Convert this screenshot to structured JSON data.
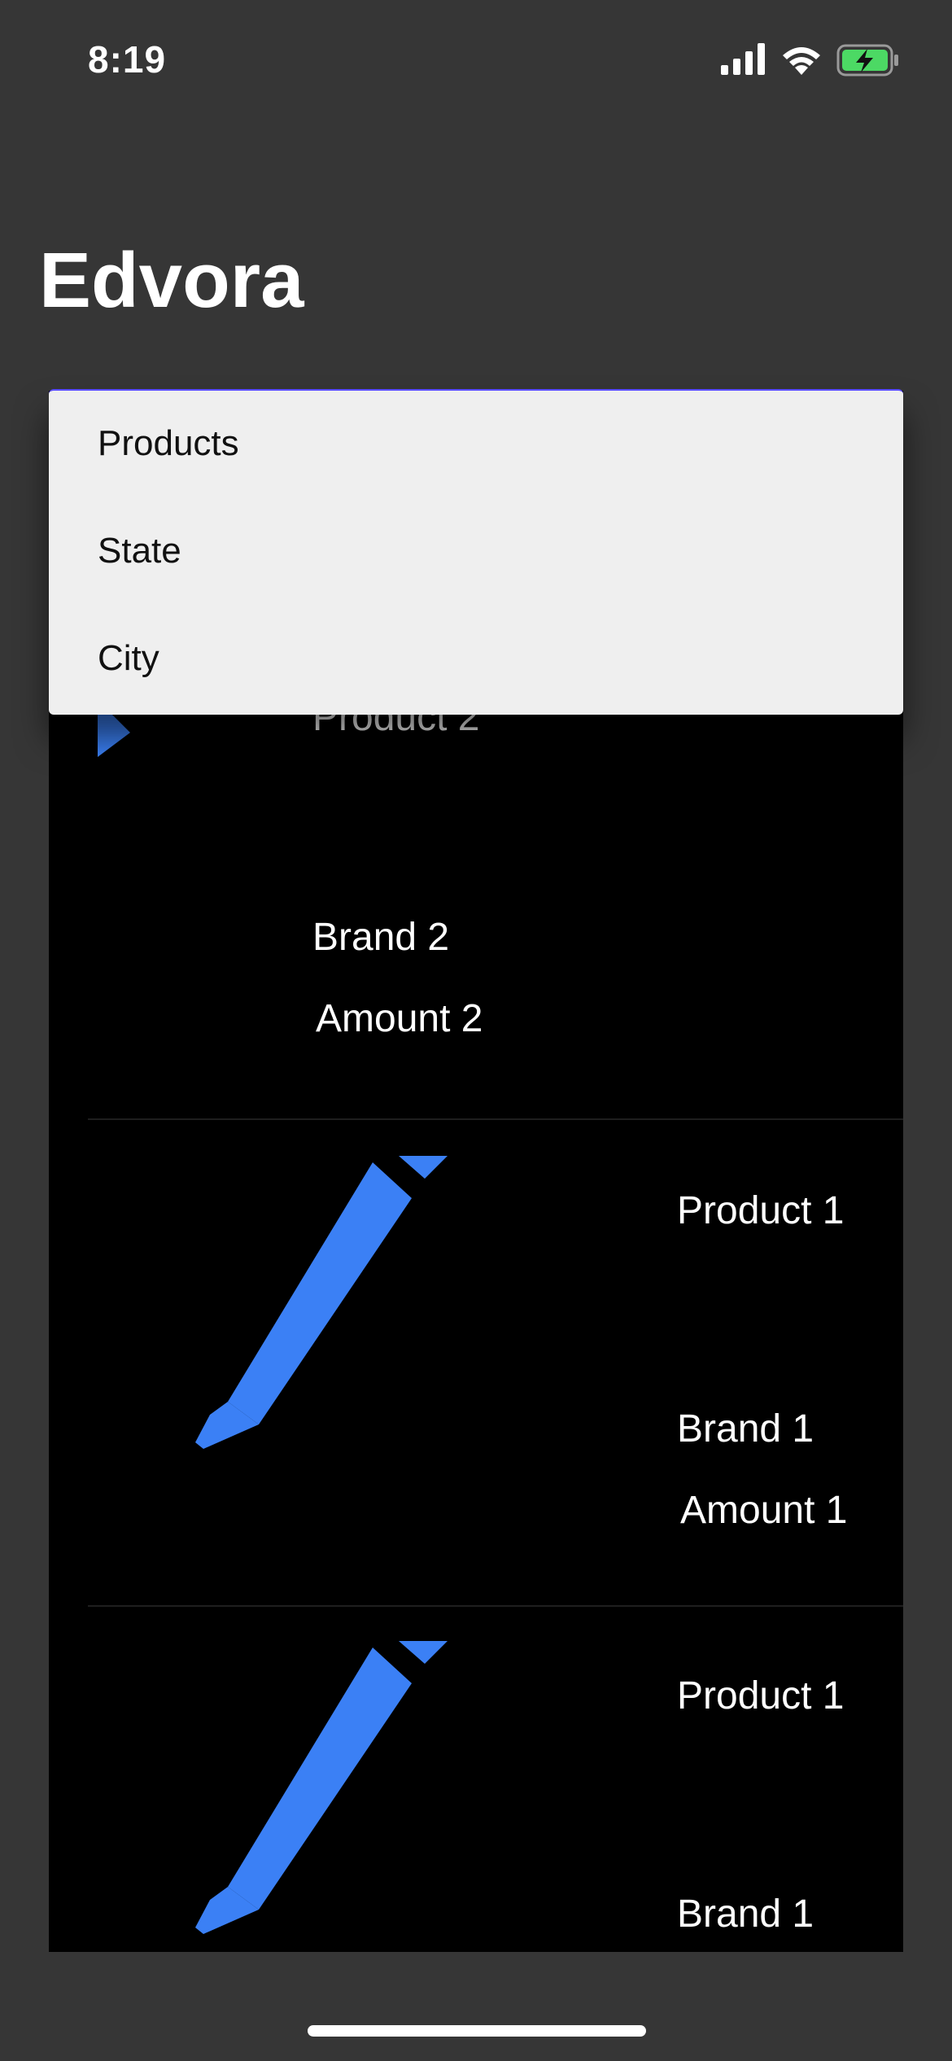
{
  "status_bar": {
    "time": "8:19",
    "icons": [
      "signal-icon",
      "wifi-icon",
      "battery-charging-icon"
    ],
    "battery_color": "#4cd964"
  },
  "app": {
    "title": "Edvora"
  },
  "dropdown": {
    "items": [
      "Products",
      "State",
      "City"
    ]
  },
  "cards": [
    {
      "product": "Product 2",
      "brand": "Brand 2",
      "amount": "Amount 2",
      "icon": "pencil-icon"
    },
    {
      "product": "Product 1",
      "brand": "Brand 1",
      "amount": "Amount 1",
      "icon": "pencil-icon"
    },
    {
      "product": "Product 1",
      "brand": "Brand 1",
      "icon": "pencil-icon"
    }
  ],
  "colors": {
    "background": "#363636",
    "panel": "#000000",
    "accent": "#3b80f5",
    "dropdown_bg": "#efefef"
  }
}
